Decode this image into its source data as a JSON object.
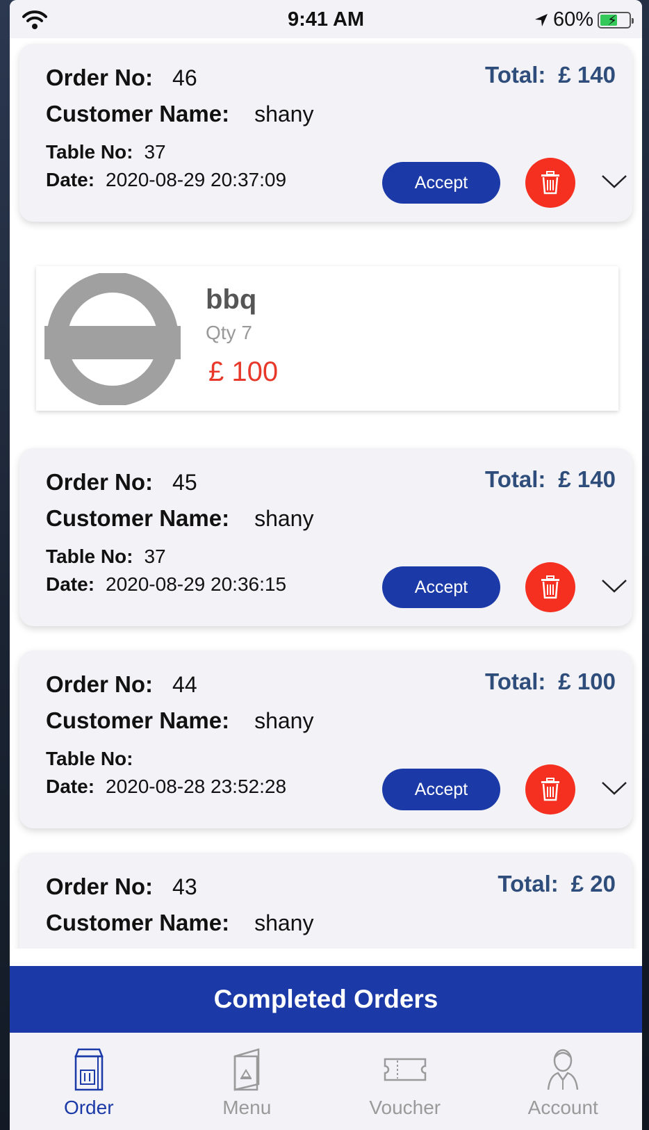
{
  "status": {
    "time": "9:41 AM",
    "battery": "60%"
  },
  "orders": [
    {
      "order_label": "Order No:",
      "order_no": "46",
      "customer_label": "Customer Name:",
      "customer": "shany",
      "table_label": "Table No:",
      "table_no": "37",
      "date_label": "Date:",
      "date": "2020-08-29 20:37:09",
      "total_label": "Total:",
      "total": "£ 140",
      "accept": "Accept"
    },
    {
      "order_label": "Order No:",
      "order_no": "45",
      "customer_label": "Customer Name:",
      "customer": "shany",
      "table_label": "Table No:",
      "table_no": "37",
      "date_label": "Date:",
      "date": "2020-08-29 20:36:15",
      "total_label": "Total:",
      "total": "£ 140",
      "accept": "Accept"
    },
    {
      "order_label": "Order No:",
      "order_no": "44",
      "customer_label": "Customer Name:",
      "customer": "shany",
      "table_label": "Table No:",
      "table_no": "",
      "date_label": "Date:",
      "date": "2020-08-28 23:52:28",
      "total_label": "Total:",
      "total": "£ 100",
      "accept": "Accept"
    },
    {
      "order_label": "Order No:",
      "order_no": "43",
      "customer_label": "Customer Name:",
      "customer": "shany",
      "total_label": "Total:",
      "total": "£ 20"
    }
  ],
  "expanded_item": {
    "name": "bbq",
    "qty": "Qty 7",
    "price": "£  100"
  },
  "completed_button": "Completed Orders",
  "tabs": [
    {
      "label": "Order",
      "icon": "order-bag-icon",
      "active": true
    },
    {
      "label": "Menu",
      "icon": "menu-book-icon",
      "active": false
    },
    {
      "label": "Voucher",
      "icon": "ticket-icon",
      "active": false
    },
    {
      "label": "Account",
      "icon": "person-icon",
      "active": false
    }
  ],
  "colors": {
    "primary": "#1b3aa8",
    "total": "#2e4d7a",
    "delete": "#f53020",
    "price": "#e8382a"
  }
}
